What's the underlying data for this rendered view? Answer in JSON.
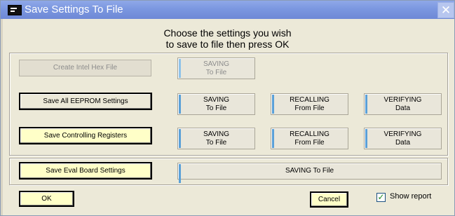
{
  "window": {
    "title": "Save Settings To File",
    "close_glyph": "✕"
  },
  "instructions": {
    "line1": "Choose the settings you wish",
    "line2": "to save to file then press OK"
  },
  "rows": {
    "hex": {
      "button": "Create Intel Hex File",
      "saving": [
        "SAVING",
        "To File"
      ]
    },
    "eeprom": {
      "button": "Save All EEPROM Settings",
      "saving": [
        "SAVING",
        "To File"
      ],
      "recalling": [
        "RECALLING",
        "From File"
      ],
      "verifying": [
        "VERIFYING",
        "Data"
      ]
    },
    "registers": {
      "button": "Save Controlling Registers",
      "saving": [
        "SAVING",
        "To File"
      ],
      "recalling": [
        "RECALLING",
        "From File"
      ],
      "verifying": [
        "VERIFYING",
        "Data"
      ]
    },
    "eval": {
      "button": "Save Eval Board Settings",
      "status": "SAVING To File"
    }
  },
  "footer": {
    "ok": "OK",
    "cancel": "Cancel",
    "show_report": "Show report",
    "show_report_checked": true,
    "check_glyph": "✓"
  }
}
